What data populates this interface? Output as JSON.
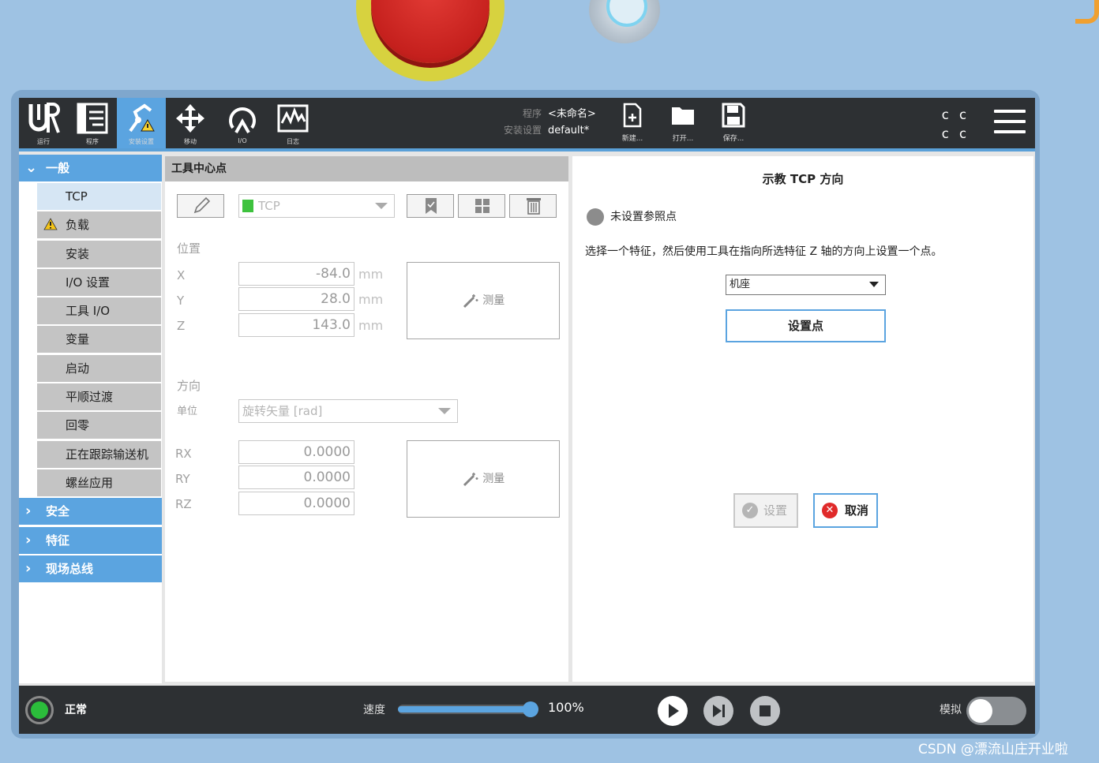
{
  "topbar": {
    "nav": [
      {
        "id": "logo",
        "label": "运行",
        "icon": "ur-logo-icon"
      },
      {
        "id": "program",
        "label": "程序",
        "icon": "program-icon"
      },
      {
        "id": "installation",
        "label": "安装设置",
        "icon": "installation-icon",
        "active": true
      },
      {
        "id": "move",
        "label": "移动",
        "icon": "move-icon"
      },
      {
        "id": "io",
        "label": "I/O",
        "icon": "io-icon"
      },
      {
        "id": "log",
        "label": "日志",
        "icon": "log-icon"
      }
    ],
    "program_key": "程序",
    "program_value": "<未命名>",
    "installation_key": "安装设置",
    "installation_value": "default*",
    "new_label": "新建...",
    "open_label": "打开...",
    "save_label": "保存..."
  },
  "sidebar": {
    "group_general": "一般",
    "items": [
      "TCP",
      "负载",
      "安装",
      "I/O 设置",
      "工具 I/O",
      "变量",
      "启动",
      "平顺过渡",
      "回零",
      "正在跟踪输送机",
      "螺丝应用"
    ],
    "sections": [
      "安全",
      "特征",
      "现场总线"
    ]
  },
  "tcp": {
    "header": "工具中心点",
    "selected_tcp": "TCP",
    "position_label": "位置",
    "x_label": "X",
    "x_value": "-84.0",
    "y_label": "Y",
    "y_value": "28.0",
    "z_label": "Z",
    "z_value": "143.0",
    "unit_mm": "mm",
    "measure_label": "测量",
    "orientation_label": "方向",
    "unit_label": "单位",
    "unit_value": "旋转矢量 [rad]",
    "rx_label": "RX",
    "rx_value": "0.0000",
    "ry_label": "RY",
    "ry_value": "0.0000",
    "rz_label": "RZ",
    "rz_value": "0.0000"
  },
  "teach": {
    "title": "示教 TCP 方向",
    "reference_status": "未设置参照点",
    "description": "选择一个特征，然后使用工具在指向所选特征 Z 轴的方向上设置一个点。",
    "feature_value": "机座",
    "set_point_label": "设置点",
    "set_label": "设置",
    "cancel_label": "取消"
  },
  "bottombar": {
    "status": "正常",
    "speed_label": "速度",
    "speed_value": "100%",
    "speed_fraction": 1.0,
    "simulation_label": "模拟"
  },
  "watermark": "CSDN @漂流山庄开业啦",
  "colors": {
    "accent": "#5ba4e0",
    "topbar": "#2d3033",
    "status_ok": "#2bbd3b",
    "cancel": "#e02a2a"
  }
}
